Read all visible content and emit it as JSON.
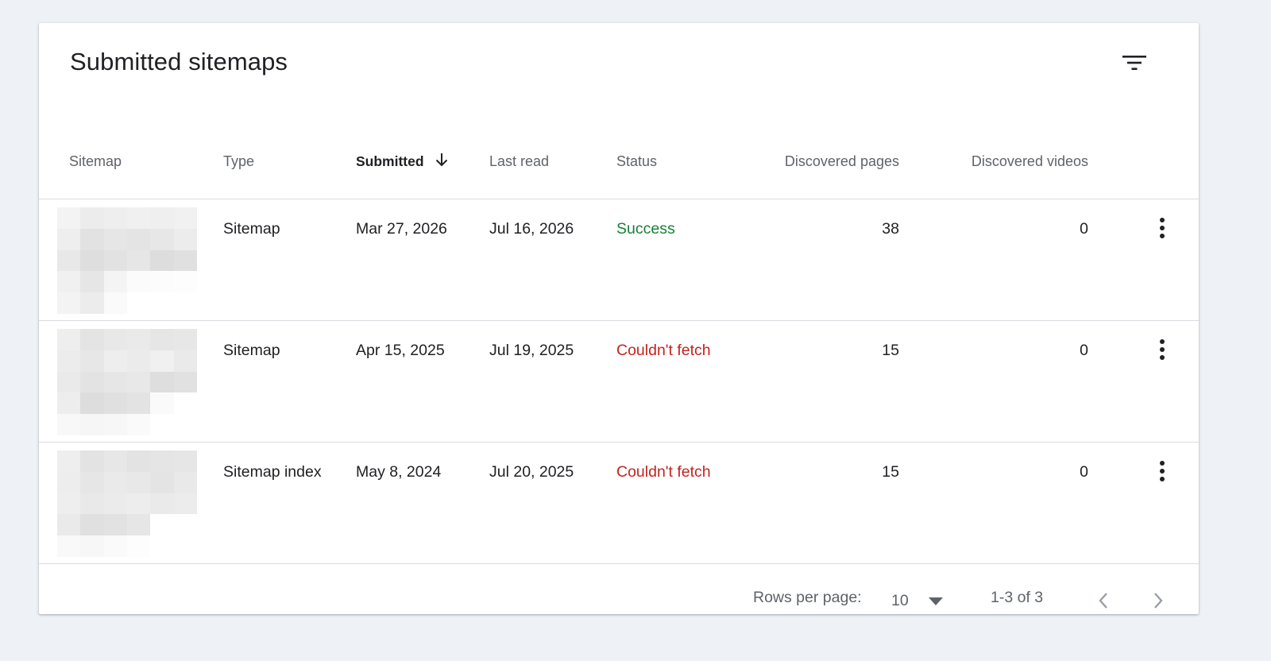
{
  "card": {
    "title": "Submitted sitemaps",
    "filter_icon": "filter-list-icon"
  },
  "columns": {
    "sitemap": "Sitemap",
    "type": "Type",
    "submitted": "Submitted",
    "last_read": "Last read",
    "status": "Status",
    "discovered_pages": "Discovered pages",
    "discovered_videos": "Discovered videos"
  },
  "sort": {
    "column": "submitted",
    "direction": "descending",
    "icon": "arrow-down-icon"
  },
  "rows": [
    {
      "type": "Sitemap",
      "submitted": "Mar 27, 2026",
      "last_read": "Jul 16, 2026",
      "status": "Success",
      "status_kind": "success",
      "discovered_pages": "38",
      "discovered_videos": "0"
    },
    {
      "type": "Sitemap",
      "submitted": "Apr 15, 2025",
      "last_read": "Jul 19, 2025",
      "status": "Couldn't fetch",
      "status_kind": "error",
      "discovered_pages": "15",
      "discovered_videos": "0"
    },
    {
      "type": "Sitemap index",
      "submitted": "May 8, 2024",
      "last_read": "Jul 20, 2025",
      "status": "Couldn't fetch",
      "status_kind": "error",
      "discovered_pages": "15",
      "discovered_videos": "0"
    }
  ],
  "footer": {
    "rows_per_page_label": "Rows per page:",
    "rows_per_page_value": "10",
    "range_text": "1-3 of 3"
  },
  "colors": {
    "background": "#eef2f7",
    "success": "#188038",
    "error": "#c5221f",
    "muted_text": "#5f6368",
    "text": "#202124"
  }
}
